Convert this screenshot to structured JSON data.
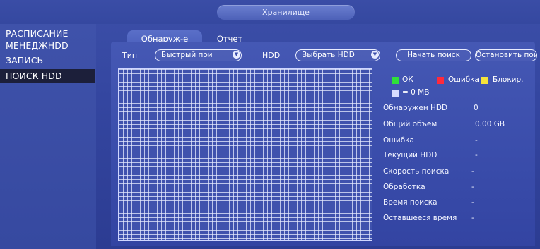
{
  "window": {
    "title": "Хранилище"
  },
  "sidebar": {
    "items": [
      {
        "label": "РАСПИСАНИЕ"
      },
      {
        "label": "МЕНЕДЖHDD"
      },
      {
        "label": "ЗАПИСЬ"
      },
      {
        "label": "ПОИСК HDD",
        "active": true
      }
    ]
  },
  "tabs": [
    {
      "label": "Обнаруж-е",
      "active": true
    },
    {
      "label": "Отчет",
      "active": false
    }
  ],
  "controls": {
    "type_label": "Тип",
    "type_value": "Быстрый пои",
    "hdd_label": "HDD",
    "hdd_value": "Выбрать HDD",
    "start_button": "Начать поиск",
    "stop_button": "Остановить поиск"
  },
  "legend": {
    "ok": {
      "label": "ОК",
      "color": "#2fe03a"
    },
    "error": {
      "label": "Ошибка",
      "color": "#ff2a3c"
    },
    "blocked": {
      "label": "Блокир.",
      "color": "#f5e33a"
    },
    "block_size": {
      "label": "= 0 MB",
      "color": "#d8dcff"
    }
  },
  "stats": [
    {
      "label": "Обнаружен HDD",
      "value": "0"
    },
    {
      "label": "Общий объем",
      "value": "0.00 GB"
    },
    {
      "label": "Ошибка",
      "value": "-"
    },
    {
      "label": "Текущий HDD",
      "value": "-"
    },
    {
      "label": "Скорость поиска",
      "value": "-"
    },
    {
      "label": "Обработка",
      "value": "-"
    },
    {
      "label": "Время поиска",
      "value": "-"
    },
    {
      "label": "Оставшееся время",
      "value": "-"
    }
  ],
  "icons": {
    "dropdown_arrow": "chevron-down-icon"
  }
}
